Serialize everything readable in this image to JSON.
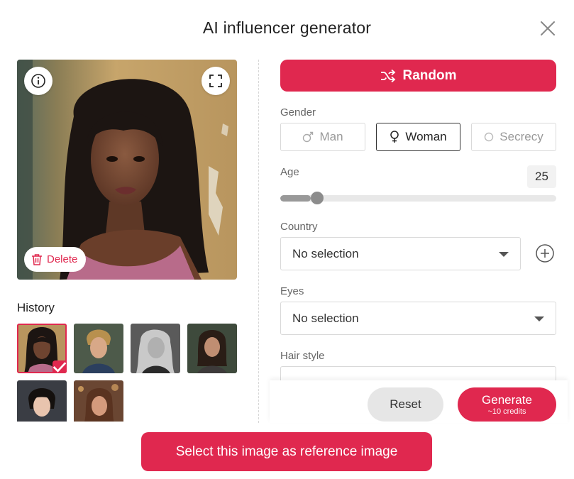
{
  "dialog": {
    "title": "AI influencer generator",
    "close_icon": "close-icon"
  },
  "preview": {
    "info_icon": "info-icon",
    "expand_icon": "fullscreen-icon",
    "delete_label": "Delete",
    "delete_icon": "trash-icon"
  },
  "history": {
    "title": "History",
    "items": [
      {
        "selected": true
      },
      {
        "selected": false
      },
      {
        "selected": false
      },
      {
        "selected": false
      },
      {
        "selected": false
      },
      {
        "selected": false
      }
    ]
  },
  "form": {
    "random_label": "Random",
    "random_icon": "shuffle-icon",
    "gender": {
      "label": "Gender",
      "options": [
        {
          "label": "Man",
          "icon": "male-icon",
          "selected": false
        },
        {
          "label": "Woman",
          "icon": "female-icon",
          "selected": true
        },
        {
          "label": "Secrecy",
          "icon": "circle-icon",
          "selected": false
        }
      ]
    },
    "age": {
      "label": "Age",
      "value": "25",
      "slider_fraction": 0.11
    },
    "country": {
      "label": "Country",
      "value": "No selection",
      "add_icon": "plus-circle-icon"
    },
    "eyes": {
      "label": "Eyes",
      "value": "No selection"
    },
    "hair_style": {
      "label": "Hair style"
    }
  },
  "actions": {
    "reset_label": "Reset",
    "generate_label": "Generate",
    "generate_sub": "~10 credits",
    "reference_label": "Select this image as reference image"
  },
  "colors": {
    "accent": "#e0284f",
    "muted": "#999999"
  }
}
